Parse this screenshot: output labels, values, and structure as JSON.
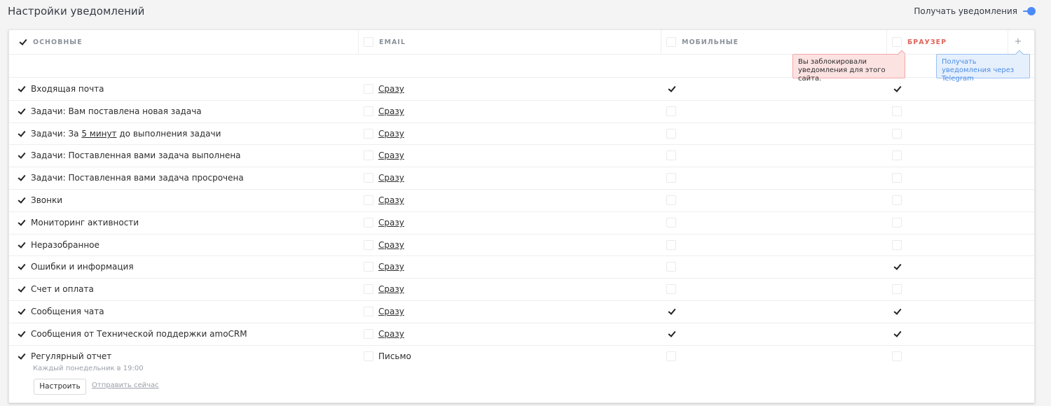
{
  "header": {
    "title": "Настройки уведомлений",
    "toggle_label": "Получать уведомления",
    "toggle_on": true,
    "accent_color": "#4c8bf7"
  },
  "columns": {
    "main": "ОСНОВНЫЕ",
    "email": "EMAIL",
    "mobile": "МОБИЛЬНЫЕ",
    "browser": "БРАУЗЕР",
    "add": "+"
  },
  "tooltips": {
    "blocked": "Вы заблокировали уведомления для этого сайта.",
    "telegram": "Получать уведомления через Telegram"
  },
  "rows": [
    {
      "label": "Входящая почта",
      "email": "Сразу",
      "mobile": true,
      "browser": true
    },
    {
      "label": "Задачи: Вам поставлена новая задача",
      "email": "Сразу",
      "mobile": false,
      "browser": false
    },
    {
      "label_pre": "Задачи: За ",
      "label_link": "5 минут",
      "label_post": " до выполнения задачи",
      "email": "Сразу",
      "mobile": false,
      "browser": false
    },
    {
      "label": "Задачи: Поставленная вами задача выполнена",
      "email": "Сразу",
      "mobile": false,
      "browser": false
    },
    {
      "label": "Задачи: Поставленная вами задача просрочена",
      "email": "Сразу",
      "mobile": false,
      "browser": false
    },
    {
      "label": "Звонки",
      "email": "Сразу",
      "mobile": false,
      "browser": false
    },
    {
      "label": "Мониторинг активности",
      "email": "Сразу",
      "mobile": false,
      "browser": false
    },
    {
      "label": "Неразобранное",
      "email": "Сразу",
      "mobile": false,
      "browser": false
    },
    {
      "label": "Ошибки и информация",
      "email": "Сразу",
      "mobile": false,
      "browser": true
    },
    {
      "label": "Счет и оплата",
      "email": "Сразу",
      "mobile": false,
      "browser": false
    },
    {
      "label": "Сообщения чата",
      "email": "Сразу",
      "mobile": true,
      "browser": true
    },
    {
      "label": "Сообщения от Технической поддержки amoCRM",
      "email": "Сразу",
      "mobile": true,
      "browser": true
    },
    {
      "label": "Регулярный отчет",
      "sub": "Каждый понедельник в 19:00",
      "email": "Письмо",
      "mobile": false,
      "browser": false
    }
  ],
  "report": {
    "setup_button": "Настроить",
    "send_now": "Отправить сейчас"
  }
}
